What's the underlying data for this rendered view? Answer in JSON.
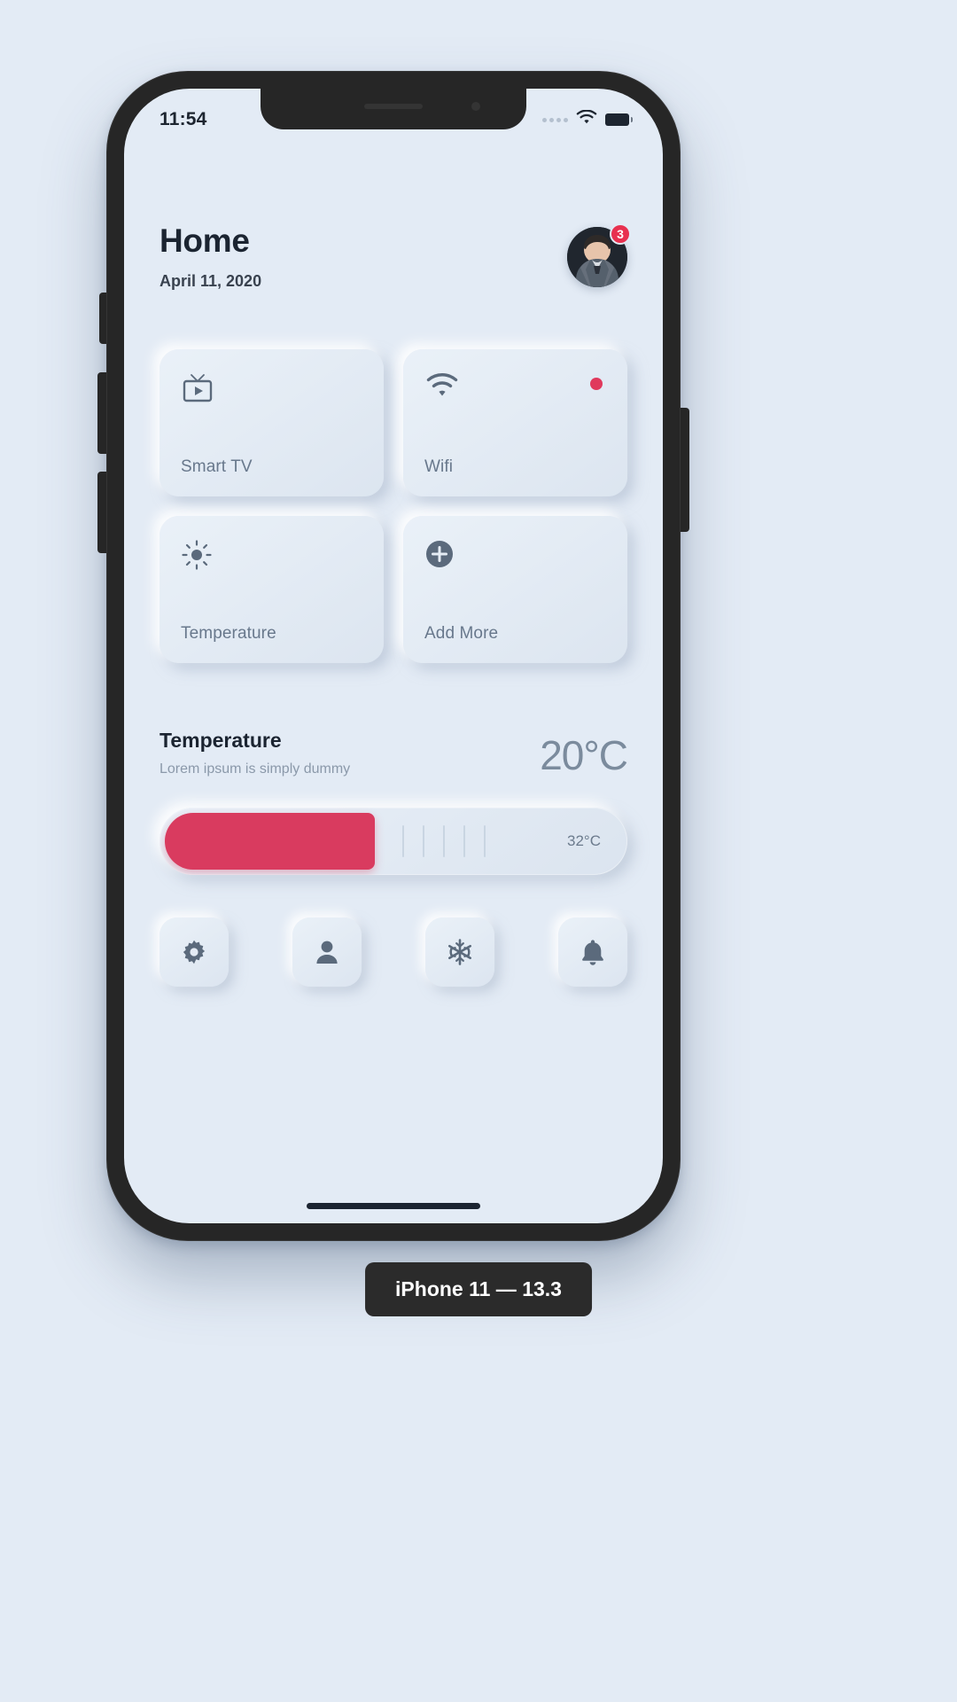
{
  "status_bar": {
    "time": "11:54",
    "signal_icon": "signal-dots-icon",
    "wifi_icon": "wifi-icon",
    "battery_icon": "battery-icon"
  },
  "header": {
    "title": "Home",
    "date": "April 11, 2020",
    "avatar_name": "user-avatar",
    "notification_count": "3"
  },
  "devices": [
    {
      "label": "Smart TV",
      "icon": "tv-icon",
      "active": false
    },
    {
      "label": "Wifi",
      "icon": "wifi-icon",
      "active": true
    },
    {
      "label": "Temperature",
      "icon": "brightness-icon",
      "active": false
    },
    {
      "label": "Add More",
      "icon": "plus-circle-icon",
      "active": false
    }
  ],
  "temperature": {
    "title": "Temperature",
    "subtitle": "Lorem ipsum is simply dummy",
    "current": "20°C",
    "max": "32°C",
    "fill_percent": 46,
    "accent_color": "#d93b5f"
  },
  "bottom_nav": [
    {
      "icon": "gear-icon",
      "name": "settings"
    },
    {
      "icon": "person-icon",
      "name": "profile"
    },
    {
      "icon": "snowflake-icon",
      "name": "cooling"
    },
    {
      "icon": "bell-icon",
      "name": "alerts"
    }
  ],
  "device_caption": "iPhone 11 — 13.3",
  "colors": {
    "background": "#e3ebf5",
    "frame": "#262626",
    "accent": "#d93b5f",
    "badge": "#e8304f",
    "text_dark": "#1b2431",
    "text_muted": "#68788c"
  }
}
